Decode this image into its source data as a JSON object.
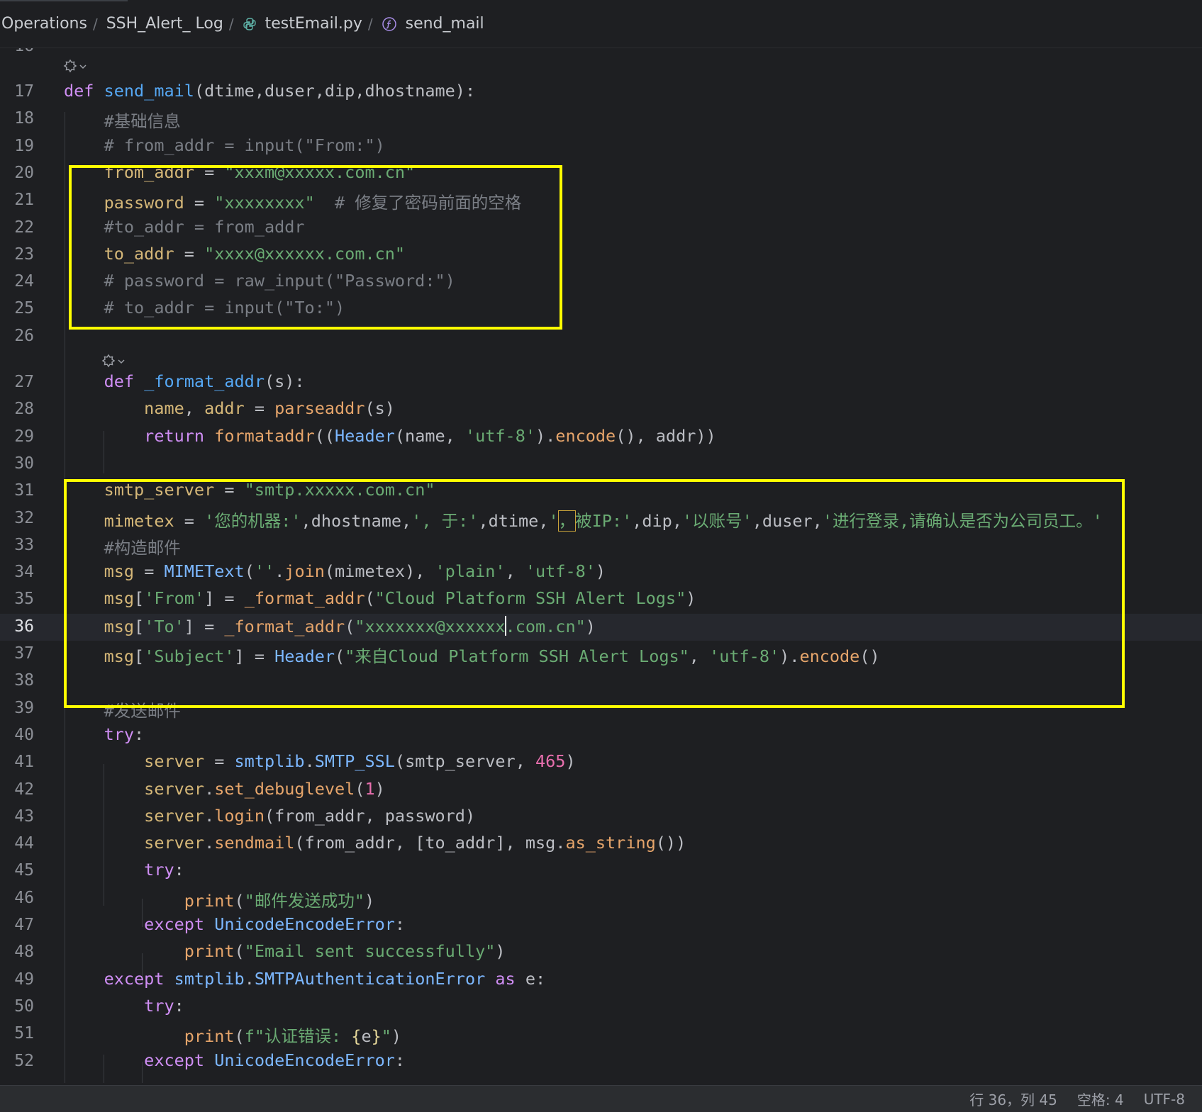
{
  "breadcrumb": {
    "items": [
      {
        "label": "Operations",
        "icon": null
      },
      {
        "label": "SSH_Alert_ Log",
        "icon": null
      },
      {
        "label": "testEmail.py",
        "icon": "python-file-icon"
      },
      {
        "label": "send_mail",
        "icon": "function-icon"
      }
    ],
    "separator": "/"
  },
  "editor": {
    "current_line": 36,
    "lines": [
      {
        "n": "17",
        "t": [
          [
            "kw",
            "def "
          ],
          [
            "fn",
            "send_mail"
          ],
          [
            "",
            "(dtime,duser,dip,dhostname):"
          ]
        ]
      },
      {
        "n": "18",
        "t": [
          [
            "cmt",
            "    #基础信息"
          ]
        ]
      },
      {
        "n": "19",
        "t": [
          [
            "cmt",
            "    # from_addr = input(\"From:\")"
          ]
        ]
      },
      {
        "n": "20",
        "t": [
          [
            "var",
            "    from_addr"
          ],
          [
            "",
            " = "
          ],
          [
            "str",
            "\"xxxm@xxxxx.com.cn\""
          ]
        ]
      },
      {
        "n": "21",
        "t": [
          [
            "var",
            "    password"
          ],
          [
            "",
            " = "
          ],
          [
            "str",
            "\"xxxxxxxx\""
          ],
          [
            "cmt",
            "  # 修复了密码前面的空格"
          ]
        ]
      },
      {
        "n": "22",
        "t": [
          [
            "cmt",
            "    #to_addr = from_addr"
          ]
        ]
      },
      {
        "n": "23",
        "t": [
          [
            "var",
            "    to_addr"
          ],
          [
            "",
            " = "
          ],
          [
            "str",
            "\"xxxx@xxxxxx.com.cn\""
          ]
        ]
      },
      {
        "n": "24",
        "t": [
          [
            "cmt",
            "    # password = raw_input(\"Password:\")"
          ]
        ]
      },
      {
        "n": "25",
        "t": [
          [
            "cmt",
            "    # to_addr = input(\"To:\")"
          ]
        ]
      },
      {
        "n": "26",
        "t": [
          [
            "",
            ""
          ]
        ]
      },
      {
        "n": "27",
        "t": [
          [
            "kw",
            "    def "
          ],
          [
            "fn",
            "_format_addr"
          ],
          [
            "",
            "(s):"
          ]
        ]
      },
      {
        "n": "28",
        "t": [
          [
            "var",
            "        name"
          ],
          [
            "",
            ", "
          ],
          [
            "var",
            "addr"
          ],
          [
            "",
            " = "
          ],
          [
            "call",
            "parseaddr"
          ],
          [
            "",
            "(s)"
          ]
        ]
      },
      {
        "n": "29",
        "t": [
          [
            "kw",
            "        return "
          ],
          [
            "call",
            "formataddr"
          ],
          [
            "",
            "(("
          ],
          [
            "cls",
            "Header"
          ],
          [
            "",
            "(name, "
          ],
          [
            "str",
            "'utf-8'"
          ],
          [
            "",
            ")."
          ],
          [
            "call",
            "encode"
          ],
          [
            "",
            "(), addr))"
          ]
        ]
      },
      {
        "n": "30",
        "t": [
          [
            "",
            ""
          ]
        ]
      },
      {
        "n": "31",
        "t": [
          [
            "var",
            "    smtp_server"
          ],
          [
            "",
            " = "
          ],
          [
            "str",
            "\"smtp.xxxxx.com.cn\""
          ]
        ]
      },
      {
        "n": "32",
        "t": [
          [
            "var",
            "    mimetex"
          ],
          [
            "",
            " = "
          ],
          [
            "str",
            "'您的机器:'"
          ],
          [
            "",
            ",dhostname,"
          ],
          [
            "str",
            "', 于:'"
          ],
          [
            "",
            ",dtime,"
          ],
          [
            "str",
            "'"
          ],
          [
            "strm",
            "，"
          ],
          [
            "str",
            "被IP:'"
          ],
          [
            "",
            ",dip,"
          ],
          [
            "str",
            "'以账号'"
          ],
          [
            "",
            ",duser,"
          ],
          [
            "str",
            "'进行登录,请确认是否为公司员工。'"
          ]
        ]
      },
      {
        "n": "33",
        "t": [
          [
            "cmt",
            "    #构造邮件"
          ]
        ]
      },
      {
        "n": "34",
        "t": [
          [
            "var",
            "    msg"
          ],
          [
            "",
            " = "
          ],
          [
            "cls",
            "MIMEText"
          ],
          [
            "",
            "("
          ],
          [
            "str",
            "''"
          ],
          [
            "",
            "."
          ],
          [
            "call",
            "join"
          ],
          [
            "",
            "(mimetex), "
          ],
          [
            "str",
            "'plain'"
          ],
          [
            "",
            ", "
          ],
          [
            "str",
            "'utf-8'"
          ],
          [
            "",
            ")"
          ]
        ]
      },
      {
        "n": "35",
        "t": [
          [
            "var",
            "    msg"
          ],
          [
            "",
            "["
          ],
          [
            "str",
            "'From'"
          ],
          [
            "",
            "] = "
          ],
          [
            "call",
            "_format_addr"
          ],
          [
            "",
            "("
          ],
          [
            "str",
            "\"Cloud Platform SSH Alert Logs\""
          ],
          [
            "",
            ")"
          ]
        ]
      },
      {
        "n": "36",
        "t": [
          [
            "var",
            "    msg"
          ],
          [
            "",
            "["
          ],
          [
            "str",
            "'To'"
          ],
          [
            "",
            "] = "
          ],
          [
            "call",
            "_format_addr"
          ],
          [
            "",
            "("
          ],
          [
            "str",
            "\"xxxxxxx@xxxxxx"
          ],
          [
            "caret",
            ""
          ],
          [
            "str",
            ".com.cn\""
          ],
          [
            "",
            ")"
          ]
        ]
      },
      {
        "n": "37",
        "t": [
          [
            "var",
            "    msg"
          ],
          [
            "",
            "["
          ],
          [
            "str",
            "'Subject'"
          ],
          [
            "",
            "] = "
          ],
          [
            "cls",
            "Header"
          ],
          [
            "",
            "("
          ],
          [
            "str",
            "\"来自Cloud Platform SSH Alert Logs\""
          ],
          [
            "",
            ", "
          ],
          [
            "str",
            "'utf-8'"
          ],
          [
            "",
            ")."
          ],
          [
            "call",
            "encode"
          ],
          [
            "",
            "()"
          ]
        ]
      },
      {
        "n": "38",
        "t": [
          [
            "",
            ""
          ]
        ]
      },
      {
        "n": "39",
        "t": [
          [
            "cmt",
            "    #发送邮件"
          ]
        ]
      },
      {
        "n": "40",
        "t": [
          [
            "kw",
            "    try"
          ],
          [
            "",
            ":"
          ]
        ]
      },
      {
        "n": "41",
        "t": [
          [
            "var",
            "        server"
          ],
          [
            "",
            " = "
          ],
          [
            "cls",
            "smtplib"
          ],
          [
            "",
            "."
          ],
          [
            "cls",
            "SMTP_SSL"
          ],
          [
            "",
            "(smtp_server, "
          ],
          [
            "num",
            "465"
          ],
          [
            "",
            ")"
          ]
        ]
      },
      {
        "n": "42",
        "t": [
          [
            "var",
            "        server"
          ],
          [
            "",
            "."
          ],
          [
            "call",
            "set_debuglevel"
          ],
          [
            "",
            "("
          ],
          [
            "num",
            "1"
          ],
          [
            "",
            ")"
          ]
        ]
      },
      {
        "n": "43",
        "t": [
          [
            "var",
            "        server"
          ],
          [
            "",
            "."
          ],
          [
            "call",
            "login"
          ],
          [
            "",
            "(from_addr, password)"
          ]
        ]
      },
      {
        "n": "44",
        "t": [
          [
            "var",
            "        server"
          ],
          [
            "",
            "."
          ],
          [
            "call",
            "sendmail"
          ],
          [
            "",
            "(from_addr, [to_addr], msg."
          ],
          [
            "call",
            "as_string"
          ],
          [
            "",
            "())"
          ]
        ]
      },
      {
        "n": "45",
        "t": [
          [
            "kw",
            "        try"
          ],
          [
            "",
            ":"
          ]
        ]
      },
      {
        "n": "46",
        "t": [
          [
            "call",
            "            print"
          ],
          [
            "",
            "("
          ],
          [
            "str",
            "\"邮件发送成功\""
          ],
          [
            "",
            ")"
          ]
        ]
      },
      {
        "n": "47",
        "t": [
          [
            "kw",
            "        except "
          ],
          [
            "cls",
            "UnicodeEncodeError"
          ],
          [
            "",
            ":"
          ]
        ]
      },
      {
        "n": "48",
        "t": [
          [
            "call",
            "            print"
          ],
          [
            "",
            "("
          ],
          [
            "str",
            "\"Email sent successfully\""
          ],
          [
            "",
            ")"
          ]
        ]
      },
      {
        "n": "49",
        "t": [
          [
            "kw",
            "    except "
          ],
          [
            "cls",
            "smtplib"
          ],
          [
            "",
            "."
          ],
          [
            "cls",
            "SMTPAuthenticationError"
          ],
          [
            "kw",
            " as "
          ],
          [
            "",
            "e:"
          ]
        ]
      },
      {
        "n": "50",
        "t": [
          [
            "kw",
            "        try"
          ],
          [
            "",
            ":"
          ]
        ]
      },
      {
        "n": "51",
        "t": [
          [
            "call",
            "            print"
          ],
          [
            "",
            "("
          ],
          [
            "str",
            "f\"认证错误: "
          ],
          [
            "brk",
            "{"
          ],
          [
            "",
            "e"
          ],
          [
            "brk",
            "}"
          ],
          [
            "str",
            "\""
          ],
          [
            "",
            ")"
          ]
        ]
      },
      {
        "n": "52",
        "t": [
          [
            "kw",
            "        except "
          ],
          [
            "cls",
            "UnicodeEncodeError"
          ],
          [
            "",
            ":"
          ]
        ]
      }
    ]
  },
  "status": {
    "position": "行 36，列 45",
    "indent": "空格: 4",
    "encoding": "UTF-8"
  }
}
